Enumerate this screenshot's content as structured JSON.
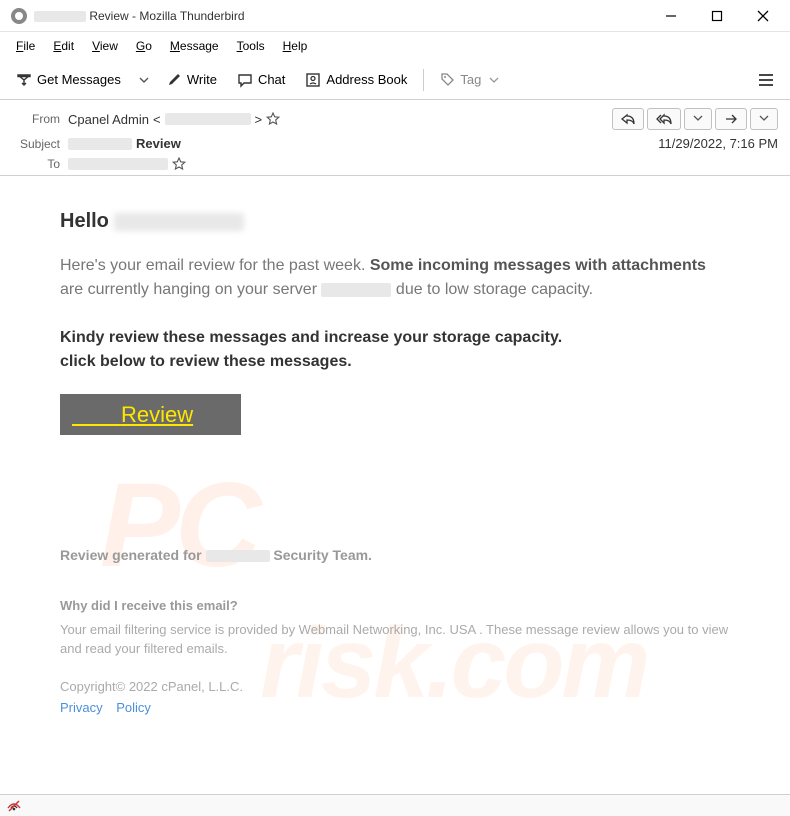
{
  "window": {
    "title_prefix_redacted": true,
    "title_suffix": "Review - Mozilla Thunderbird"
  },
  "menubar": {
    "items": [
      "File",
      "Edit",
      "View",
      "Go",
      "Message",
      "Tools",
      "Help"
    ]
  },
  "toolbar": {
    "get_messages": "Get Messages",
    "write": "Write",
    "chat": "Chat",
    "address_book": "Address Book",
    "tag": "Tag"
  },
  "header": {
    "from_label": "From",
    "from_name": "Cpanel Admin",
    "from_open": " < ",
    "from_close": " > ",
    "subject_label": "Subject",
    "subject_bold": "Review",
    "to_label": "To",
    "date": "11/29/2022, 7:16 PM"
  },
  "body": {
    "hello": "Hello ",
    "p1_a": "Here's your email review for the past week. ",
    "p1_strong": "Some incoming messages with attachments",
    "p1_b": " are currently hanging on your server ",
    "p1_c": " due to low storage capacity.",
    "p2_a": "Kindy review these messages and increase your storage capacity.",
    "p2_b": "click below to review these messages.",
    "review_btn": "Review",
    "gen_a": "Review generated for ",
    "gen_b": " Security Team.",
    "why_title": "Why did I receive this email?",
    "why_text": "Your email filtering service is provided by Webmail Networking, Inc. USA . These message review allows you to view and read your filtered emails.",
    "copyright": "Copyright© 2022 cPanel, L.L.C.",
    "link_privacy": "Privacy",
    "link_policy": "Policy"
  }
}
